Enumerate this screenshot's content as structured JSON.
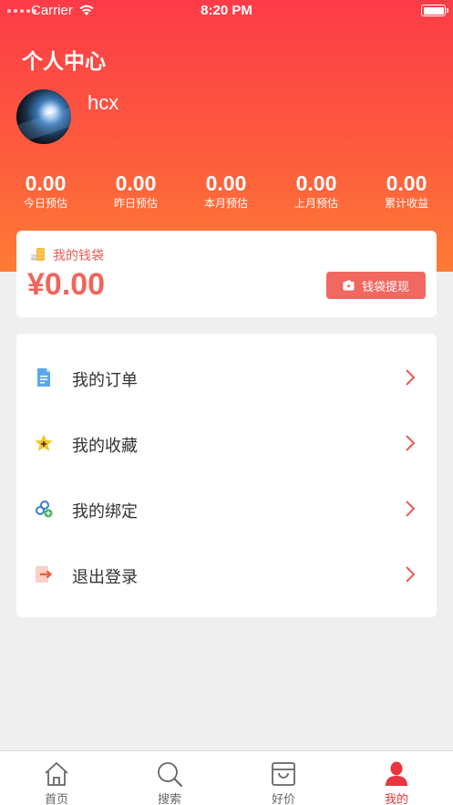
{
  "status_bar": {
    "carrier": "Carrier",
    "time": "8:20 PM"
  },
  "header": {
    "title": "个人中心",
    "username": "hcx"
  },
  "stats": [
    {
      "value": "0.00",
      "label": "今日预估"
    },
    {
      "value": "0.00",
      "label": "昨日预估"
    },
    {
      "value": "0.00",
      "label": "本月预估"
    },
    {
      "value": "0.00",
      "label": "上月预估"
    },
    {
      "value": "0.00",
      "label": "累计收益"
    }
  ],
  "wallet": {
    "label": "我的钱袋",
    "amount": "¥0.00",
    "withdraw_label": "钱袋提现"
  },
  "menu": [
    {
      "label": "我的订单",
      "icon": "order-document-icon"
    },
    {
      "label": "我的收藏",
      "icon": "star-icon"
    },
    {
      "label": "我的绑定",
      "icon": "link-binding-icon"
    },
    {
      "label": "退出登录",
      "icon": "logout-icon"
    }
  ],
  "tabbar": [
    {
      "label": "首页",
      "icon": "home-icon"
    },
    {
      "label": "搜索",
      "icon": "search-icon"
    },
    {
      "label": "好价",
      "icon": "bag-icon"
    },
    {
      "label": "我的",
      "icon": "user-icon",
      "active": true
    }
  ],
  "colors": {
    "header_top": "#fd3b48",
    "header_bottom": "#fe7b35",
    "accent": "#f0685f",
    "tab_active": "#e8353f",
    "background": "#efefef"
  }
}
